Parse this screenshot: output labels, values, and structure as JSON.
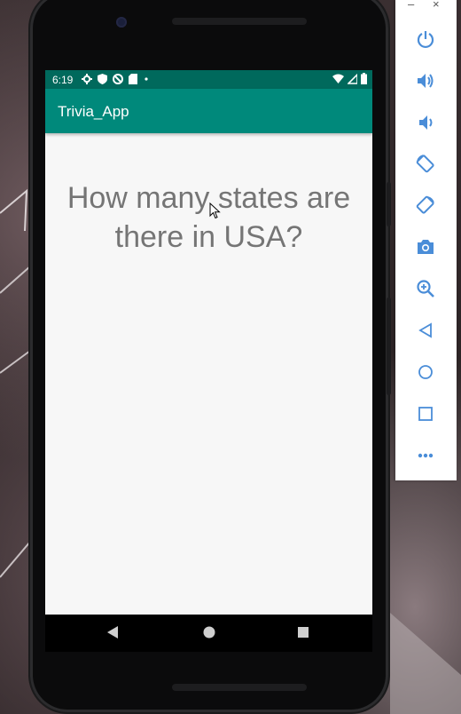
{
  "status_bar": {
    "time": "6:19"
  },
  "app_bar": {
    "title": "Trivia_App"
  },
  "question": {
    "text": "How many states are there in USA?"
  },
  "emulator_sidebar": {
    "window_controls": [
      "–",
      "×"
    ],
    "items": [
      {
        "icon": "power-icon"
      },
      {
        "icon": "volume-up-icon"
      },
      {
        "icon": "volume-down-icon"
      },
      {
        "icon": "rotate-left-icon"
      },
      {
        "icon": "rotate-right-icon"
      },
      {
        "icon": "camera-icon"
      },
      {
        "icon": "zoom-icon"
      },
      {
        "icon": "back-icon"
      },
      {
        "icon": "home-icon"
      },
      {
        "icon": "overview-icon"
      },
      {
        "icon": "more-icon"
      }
    ]
  },
  "colors": {
    "status_bar": "#00695c",
    "app_bar": "#00897b",
    "screen_bg": "#f7f7f7",
    "question_text": "#757575",
    "sidebar_icons": "#4a8dd8"
  }
}
